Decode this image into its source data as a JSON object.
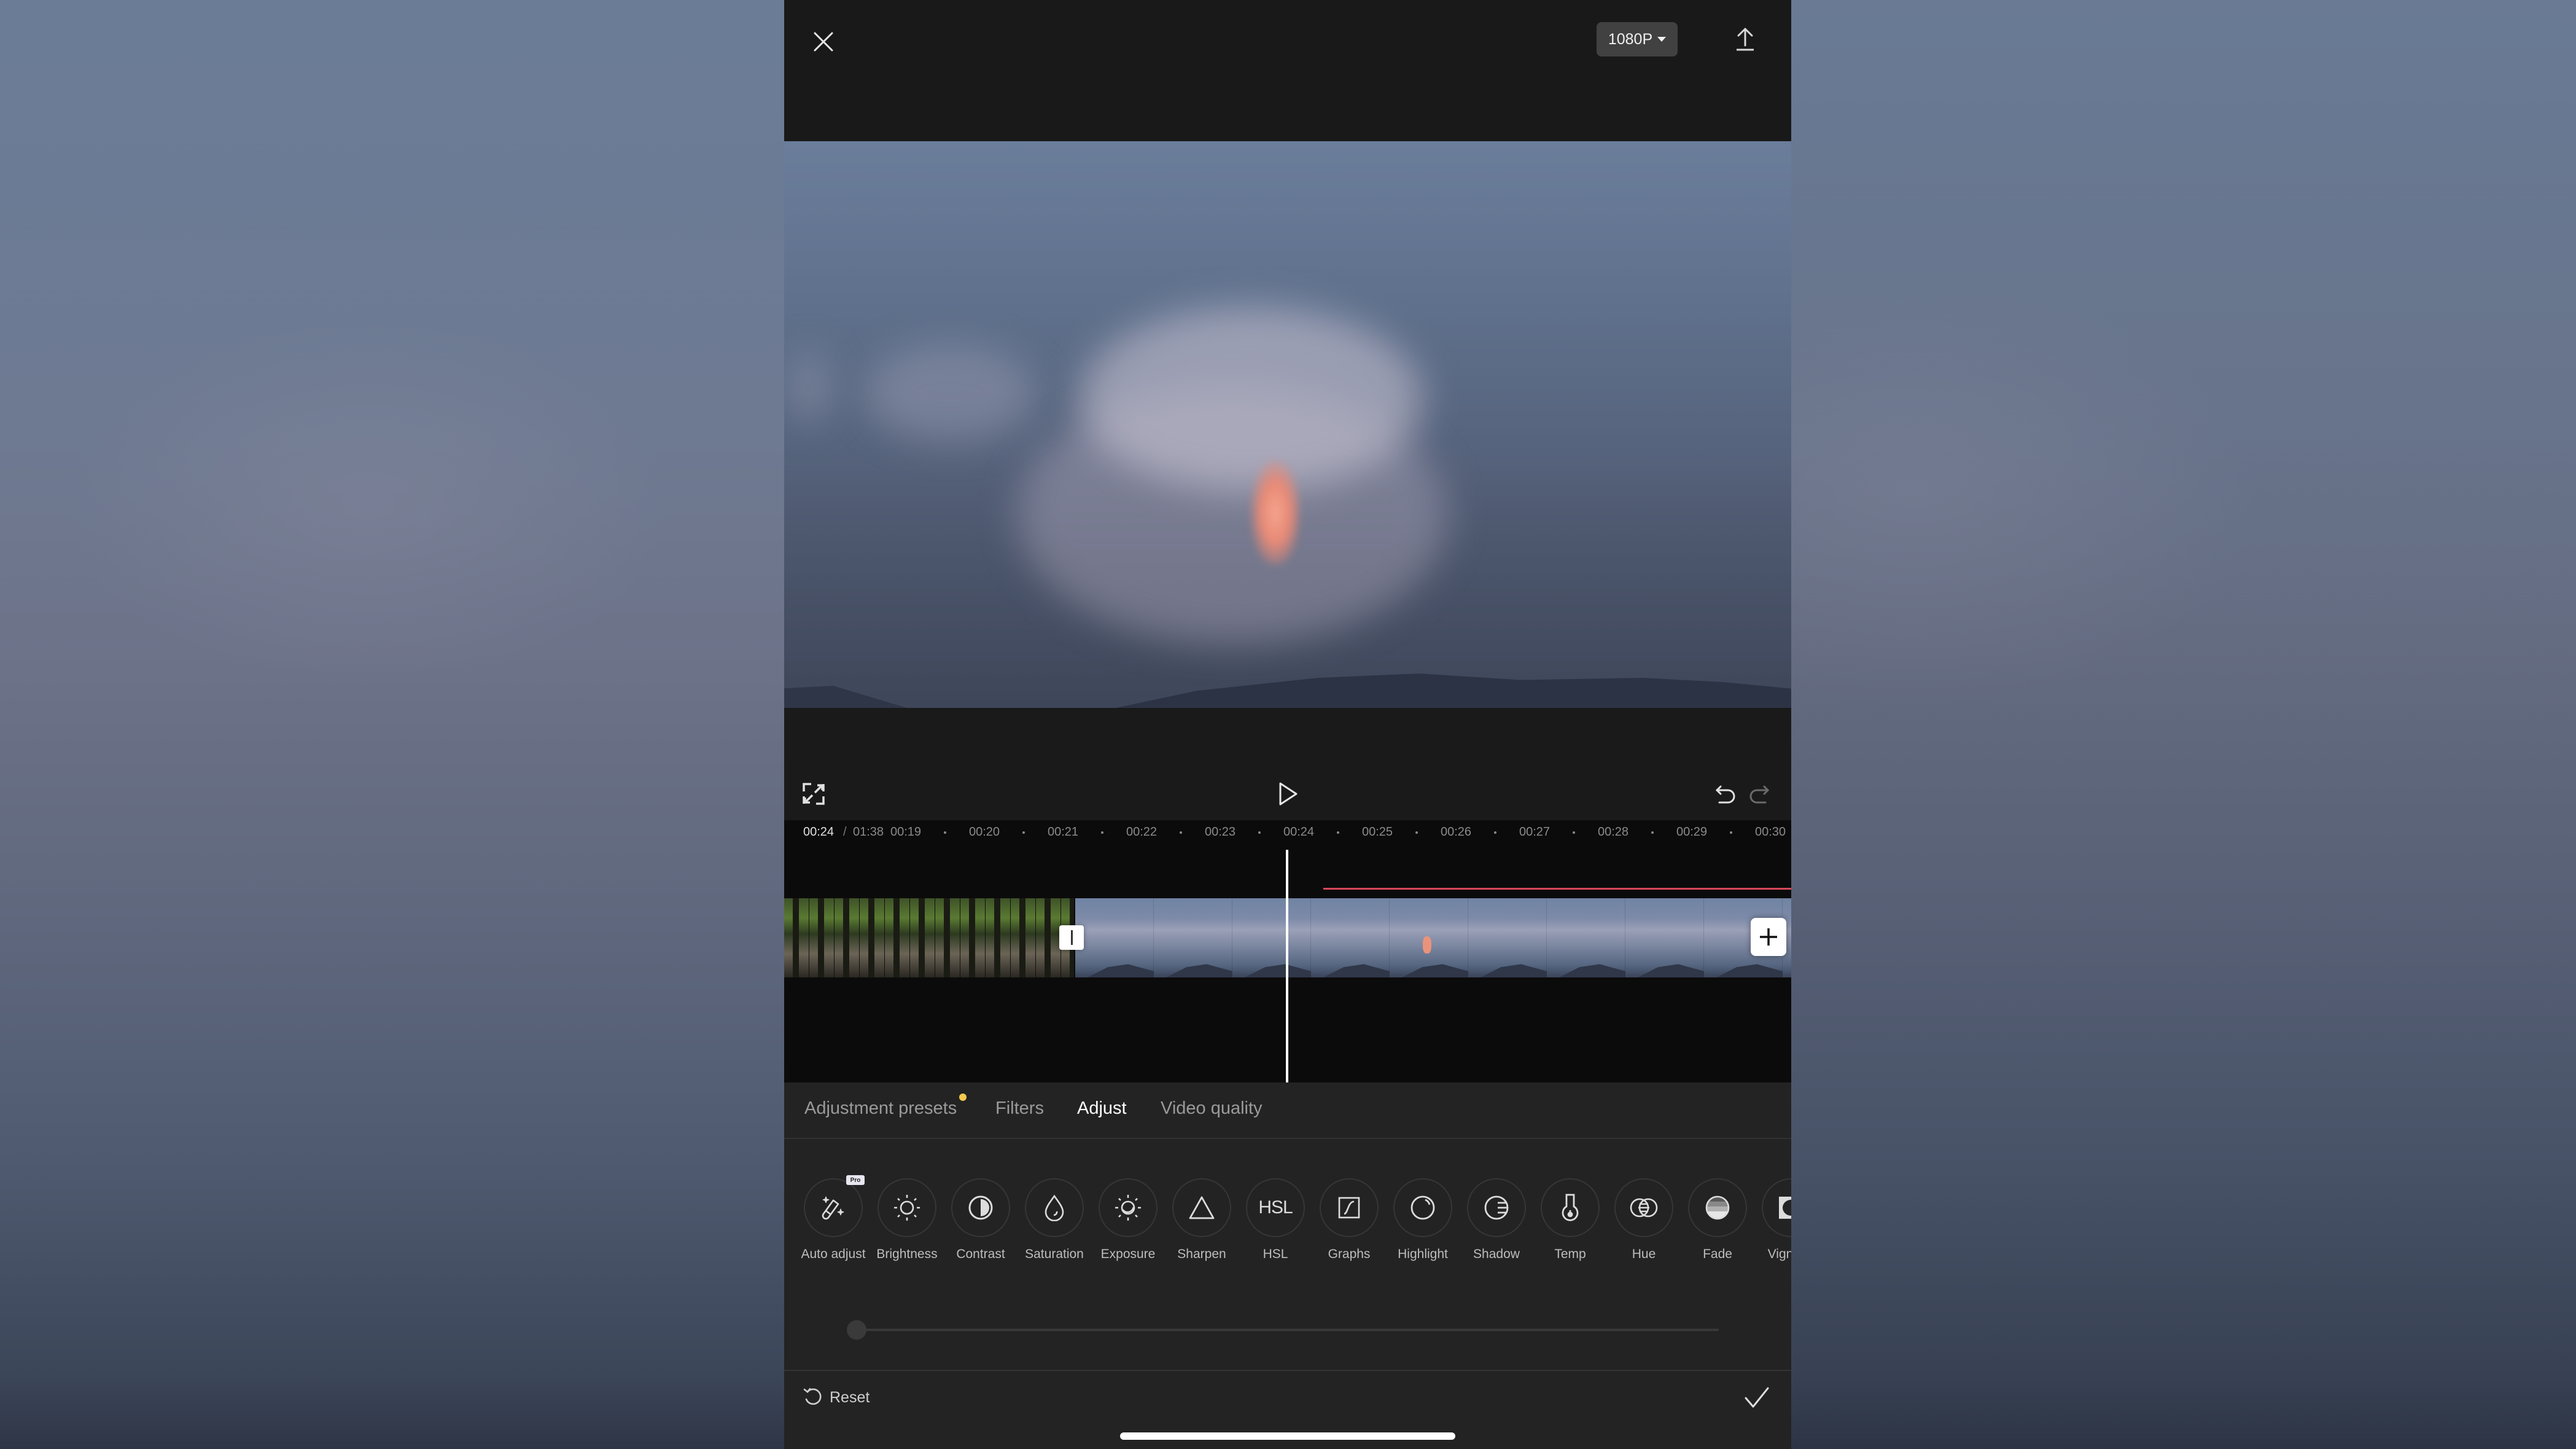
{
  "topbar": {
    "close_icon": "close-icon",
    "resolution_label": "1080P",
    "resolution_caret_icon": "caret-down-icon",
    "export_icon": "export-upload-icon"
  },
  "preview": {
    "description": "Storm cloud at dusk with pink-orange lightning glow over distant hills"
  },
  "controls": {
    "fullscreen_icon": "fullscreen-icon",
    "play_icon": "play-icon",
    "undo_icon": "undo-icon",
    "redo_icon": "redo-icon",
    "redo_enabled": false
  },
  "timeline": {
    "current_time": "00:24",
    "separator": "/",
    "total_time": "01:38",
    "ticks": [
      "00:19",
      "00:20",
      "00:21",
      "00:22",
      "00:23",
      "00:24",
      "00:25",
      "00:26",
      "00:27",
      "00:28",
      "00:29",
      "00:30"
    ],
    "playhead_time": "00:24",
    "clips": [
      {
        "name": "forest-clip",
        "frames": 12
      },
      {
        "name": "storm-sky-clip",
        "frames": 10
      }
    ],
    "split_icon": "split-handle-icon",
    "add_clip_icon": "plus-icon",
    "marker_color": "#d9485a"
  },
  "panel": {
    "tabs": [
      {
        "label": "Adjustment presets",
        "active": false,
        "has_dot": true
      },
      {
        "label": "Filters",
        "active": false,
        "has_dot": false
      },
      {
        "label": "Adjust",
        "active": true,
        "has_dot": false
      },
      {
        "label": "Video quality",
        "active": false,
        "has_dot": false
      }
    ],
    "dot_color": "#f2c94c",
    "tools": [
      {
        "label": "Auto adjust",
        "icon": "magic-wand-icon",
        "badge": "Pro"
      },
      {
        "label": "Brightness",
        "icon": "sun-icon"
      },
      {
        "label": "Contrast",
        "icon": "contrast-icon"
      },
      {
        "label": "Saturation",
        "icon": "droplet-icon"
      },
      {
        "label": "Exposure",
        "icon": "exposure-icon"
      },
      {
        "label": "Sharpen",
        "icon": "triangle-icon"
      },
      {
        "label": "HSL",
        "icon": "hsl-text-icon",
        "icon_text": "HSL"
      },
      {
        "label": "Graphs",
        "icon": "curve-graph-icon"
      },
      {
        "label": "Highlight",
        "icon": "highlight-icon"
      },
      {
        "label": "Shadow",
        "icon": "shadow-icon"
      },
      {
        "label": "Temp",
        "icon": "thermometer-icon"
      },
      {
        "label": "Hue",
        "icon": "hue-rings-icon"
      },
      {
        "label": "Fade",
        "icon": "fade-icon"
      },
      {
        "label": "Vignette",
        "icon": "vignette-icon"
      }
    ],
    "slider": {
      "value": 0,
      "min": 0,
      "max": 100
    },
    "reset_label": "Reset",
    "reset_icon": "reset-icon",
    "confirm_icon": "checkmark-icon"
  }
}
